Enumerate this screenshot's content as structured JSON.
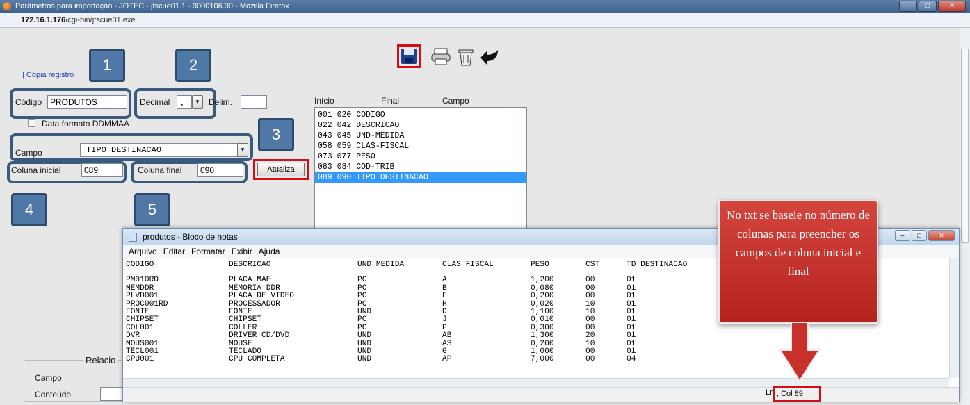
{
  "browser": {
    "title": "Parâmetros para importação - JOTEC - jtscue01.1 - 0000106.00 - Mozilla Firefox",
    "url_host": "172.16.1.176",
    "url_path": "/cgi-bin/jtscue01.exe"
  },
  "form": {
    "copy_link": "| Cópia registro",
    "codigo_label": "Código",
    "codigo_value": "PRODUTOS",
    "decimal_label": "Decimal",
    "decimal_value": ",",
    "delim_label": "Delim.",
    "data_formato_label": "Data formato DDMMAA",
    "campo_label": "Campo",
    "campo_value": "TIPO DESTINACAO",
    "coluna_inicial_label": "Coluna inicial",
    "coluna_inicial_value": "089",
    "coluna_final_label": "Coluna final",
    "coluna_final_value": "090",
    "atualiza_label": "Atualiza",
    "list_headers": {
      "inicio": "Início",
      "final": "Final",
      "campo": "Campo"
    },
    "list_items": [
      "001 020 CODIGO",
      "022 042 DESCRICAO",
      "043 045 UND-MEDIDA",
      "058 059 CLAS-FISCAL",
      "073 077 PESO",
      "083 084 COD-TRIB",
      "089 090 TIPO DESTINACAO"
    ],
    "relacio_label": "Relacio",
    "bottom_campo_label": "Campo",
    "bottom_conteudo_label": "Conteúdo"
  },
  "callouts": [
    "1",
    "2",
    "3",
    "4",
    "5"
  ],
  "notepad": {
    "title": "produtos - Bloco de notas",
    "menu": [
      "Arquivo",
      "Editar",
      "Formatar",
      "Exibir",
      "Ajuda"
    ],
    "headers": [
      "CODIGO",
      "DESCRICAO",
      "UND MEDIDA",
      "CLAS FISCAL",
      "PESO",
      "CST",
      "TD DESTINACAO"
    ],
    "rows": [
      [
        "PM010RD",
        "PLACA MAE",
        "PC",
        "A",
        "1,200",
        "00",
        "01"
      ],
      [
        "MEMDDR",
        "MEMORIA DDR",
        "PC",
        "B",
        "0,080",
        "00",
        "01"
      ],
      [
        "PLVD001",
        "PLACA DE VIDEO",
        "PC",
        "F",
        "0,200",
        "00",
        "01"
      ],
      [
        "PROC001RD",
        "PROCESSADOR",
        "PC",
        "H",
        "0,020",
        "10",
        "01"
      ],
      [
        "FONTE",
        "FONTE",
        "UND",
        "D",
        "1,100",
        "10",
        "01"
      ],
      [
        "CHIPSET",
        "CHIPSET",
        "PC",
        "J",
        "0,010",
        "00",
        "01"
      ],
      [
        "COL001",
        "COLLER",
        "PC",
        "P",
        "0,300",
        "00",
        "01"
      ],
      [
        "DVR",
        "DRIVER CD/DVD",
        "UND",
        "AB",
        "1,300",
        "20",
        "01"
      ],
      [
        "MOUS001",
        "MOUSE",
        "UND",
        "AS",
        "0,200",
        "10",
        "01"
      ],
      [
        "TECL001",
        "TECLADO",
        "UND",
        "G",
        "1,000",
        "00",
        "01"
      ],
      [
        "CPU001",
        "CPU COMPLETA",
        "UND",
        "AP",
        "7,000",
        "00",
        "04"
      ]
    ],
    "status_ln": "Ln",
    "status_col": ", Col 89"
  },
  "annotation": "No txt se baseie no número de colunas para preencher os campos de coluna inicial e final",
  "colors": {
    "highlight": "#d00e1a",
    "callout_fill": "#4f78a6",
    "selection": "#3399ff"
  }
}
